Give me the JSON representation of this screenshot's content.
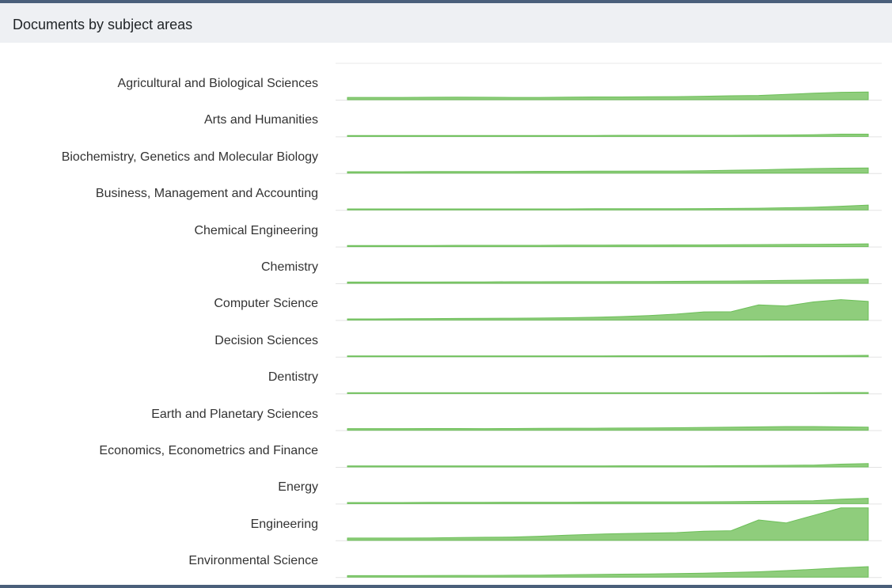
{
  "header": {
    "title": "Documents by subject areas"
  },
  "colors": {
    "fill": "#8fcd7c",
    "stroke": "#6cbf58",
    "baseline": "#e3e3e3",
    "gridline": "#e8e8e8"
  },
  "chart_data": {
    "type": "area",
    "title": "",
    "xlabel": "",
    "ylabel": "",
    "grid": true,
    "shared_scale": true,
    "ymax": 1.0,
    "series": [
      {
        "name": "Agricultural and Biological Sciences",
        "values": [
          0.1,
          0.1,
          0.1,
          0.11,
          0.12,
          0.11,
          0.1,
          0.1,
          0.12,
          0.13,
          0.13,
          0.14,
          0.15,
          0.18,
          0.21,
          0.23,
          0.3,
          0.38,
          0.44,
          0.46
        ]
      },
      {
        "name": "Arts and Humanities",
        "values": [
          0.01,
          0.01,
          0.01,
          0.01,
          0.01,
          0.01,
          0.01,
          0.01,
          0.01,
          0.01,
          0.02,
          0.02,
          0.02,
          0.02,
          0.02,
          0.03,
          0.04,
          0.06,
          0.1,
          0.1
        ]
      },
      {
        "name": "Biochemistry, Genetics and Molecular Biology",
        "values": [
          0.04,
          0.04,
          0.04,
          0.05,
          0.05,
          0.05,
          0.06,
          0.07,
          0.07,
          0.08,
          0.08,
          0.09,
          0.09,
          0.11,
          0.14,
          0.17,
          0.21,
          0.25,
          0.28,
          0.29
        ]
      },
      {
        "name": "Business, Management and Accounting",
        "values": [
          0.01,
          0.01,
          0.01,
          0.01,
          0.01,
          0.01,
          0.01,
          0.01,
          0.01,
          0.02,
          0.02,
          0.02,
          0.02,
          0.03,
          0.04,
          0.06,
          0.09,
          0.12,
          0.19,
          0.27
        ]
      },
      {
        "name": "Chemical Engineering",
        "values": [
          0.02,
          0.02,
          0.02,
          0.02,
          0.03,
          0.03,
          0.03,
          0.03,
          0.04,
          0.04,
          0.05,
          0.05,
          0.06,
          0.06,
          0.07,
          0.08,
          0.09,
          0.1,
          0.11,
          0.13
        ]
      },
      {
        "name": "Chemistry",
        "values": [
          0.03,
          0.03,
          0.03,
          0.03,
          0.04,
          0.04,
          0.05,
          0.05,
          0.06,
          0.06,
          0.07,
          0.07,
          0.08,
          0.09,
          0.1,
          0.12,
          0.14,
          0.17,
          0.2,
          0.22
        ]
      },
      {
        "name": "Computer Science",
        "values": [
          0.02,
          0.02,
          0.03,
          0.04,
          0.05,
          0.06,
          0.07,
          0.08,
          0.1,
          0.13,
          0.18,
          0.24,
          0.34,
          0.49,
          0.5,
          0.95,
          0.88,
          1.15,
          1.3,
          1.18
        ]
      },
      {
        "name": "Decision Sciences",
        "values": [
          0.0,
          0.0,
          0.0,
          0.0,
          0.0,
          0.0,
          0.0,
          0.0,
          0.0,
          0.0,
          0.01,
          0.01,
          0.01,
          0.01,
          0.01,
          0.01,
          0.02,
          0.02,
          0.03,
          0.04
        ]
      },
      {
        "name": "Dentistry",
        "values": [
          0.0,
          0.0,
          0.0,
          0.0,
          0.0,
          0.0,
          0.0,
          0.0,
          0.0,
          0.0,
          0.0,
          0.0,
          0.0,
          0.0,
          0.0,
          0.0,
          0.0,
          0.0,
          0.01,
          0.01
        ]
      },
      {
        "name": "Earth and Planetary Sciences",
        "values": [
          0.05,
          0.05,
          0.05,
          0.06,
          0.06,
          0.05,
          0.06,
          0.07,
          0.08,
          0.08,
          0.09,
          0.1,
          0.11,
          0.13,
          0.15,
          0.17,
          0.19,
          0.19,
          0.17,
          0.15
        ]
      },
      {
        "name": "Economics, Econometrics and Finance",
        "values": [
          0.01,
          0.01,
          0.01,
          0.01,
          0.01,
          0.01,
          0.01,
          0.01,
          0.01,
          0.01,
          0.02,
          0.02,
          0.02,
          0.02,
          0.03,
          0.04,
          0.05,
          0.07,
          0.13,
          0.17
        ]
      },
      {
        "name": "Energy",
        "values": [
          0.02,
          0.02,
          0.02,
          0.03,
          0.03,
          0.03,
          0.04,
          0.04,
          0.04,
          0.05,
          0.06,
          0.06,
          0.06,
          0.07,
          0.08,
          0.1,
          0.12,
          0.14,
          0.24,
          0.3
        ]
      },
      {
        "name": "Engineering",
        "values": [
          0.1,
          0.1,
          0.1,
          0.11,
          0.13,
          0.15,
          0.17,
          0.22,
          0.29,
          0.35,
          0.4,
          0.43,
          0.46,
          0.55,
          0.59,
          1.3,
          1.1,
          1.6,
          2.1,
          2.1
        ]
      },
      {
        "name": "Environmental Science",
        "values": [
          0.04,
          0.04,
          0.04,
          0.05,
          0.06,
          0.06,
          0.07,
          0.08,
          0.1,
          0.12,
          0.14,
          0.16,
          0.18,
          0.21,
          0.25,
          0.3,
          0.38,
          0.46,
          0.56,
          0.64
        ]
      }
    ]
  }
}
